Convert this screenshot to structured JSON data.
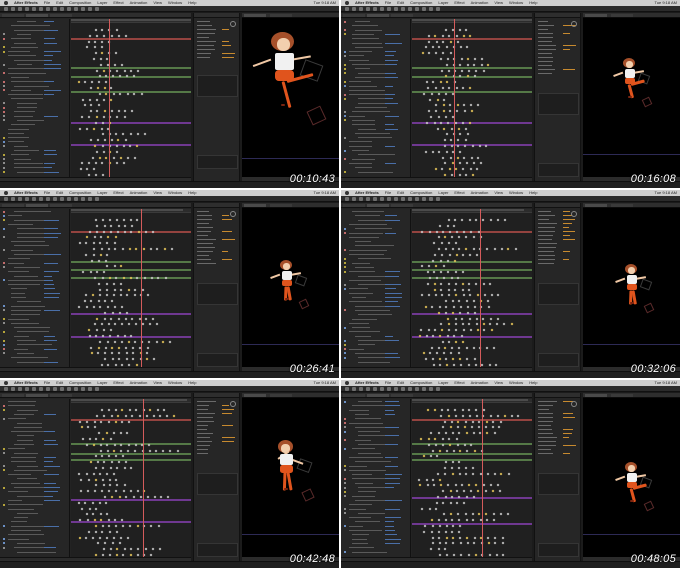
{
  "menu": {
    "app": "After Effects",
    "items": [
      "File",
      "Edit",
      "Composition",
      "Layer",
      "Effect",
      "Animation",
      "View",
      "Window",
      "Help"
    ],
    "clock": "Tue 9:18 AM"
  },
  "frames": [
    {
      "timestamp": "00:10:43",
      "character_scale": "large"
    },
    {
      "timestamp": "00:16:08",
      "character_scale": "small"
    },
    {
      "timestamp": "00:26:41",
      "character_scale": "small"
    },
    {
      "timestamp": "00:32:06",
      "character_scale": "small"
    },
    {
      "timestamp": "00:42:48",
      "character_scale": "medium"
    },
    {
      "timestamp": "00:48:05",
      "character_scale": "small"
    }
  ],
  "colors": {
    "track_red": "#a94a45",
    "track_green": "#5f8a4f",
    "track_purple": "#7e3da6",
    "track_gray": "#3a3a3a",
    "cti": "#d45b5b",
    "pants": "#e0541d",
    "hair": "#a6502a"
  }
}
